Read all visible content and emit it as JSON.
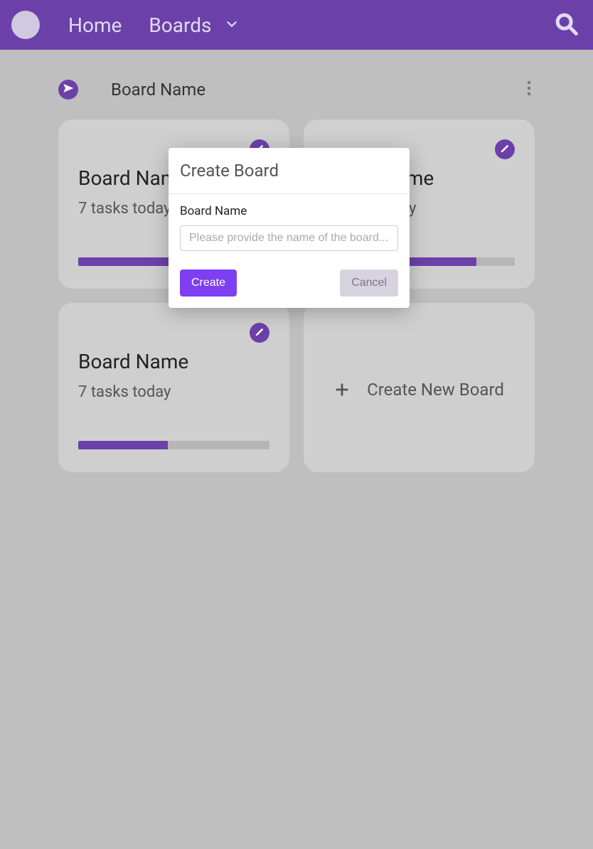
{
  "colors": {
    "brand": "#6b41a9",
    "brand_bright": "#7e3ff2"
  },
  "nav": {
    "home_label": "Home",
    "boards_label": "Boards"
  },
  "board_header": {
    "title": "Board Name"
  },
  "cards": [
    {
      "title": "Board Name",
      "subtitle": "7 tasks today",
      "progress_pct": 80
    },
    {
      "title": "Board Name",
      "subtitle": "7 tasks today",
      "progress_pct": 80
    },
    {
      "title": "Board Name",
      "subtitle": "7 tasks today",
      "progress_pct": 47
    }
  ],
  "new_board_tile": {
    "label": "Create New Board"
  },
  "modal": {
    "title": "Create Board",
    "field_label": "Board Name",
    "placeholder": "Please provide the name of the board...",
    "create_label": "Create",
    "cancel_label": "Cancel"
  }
}
